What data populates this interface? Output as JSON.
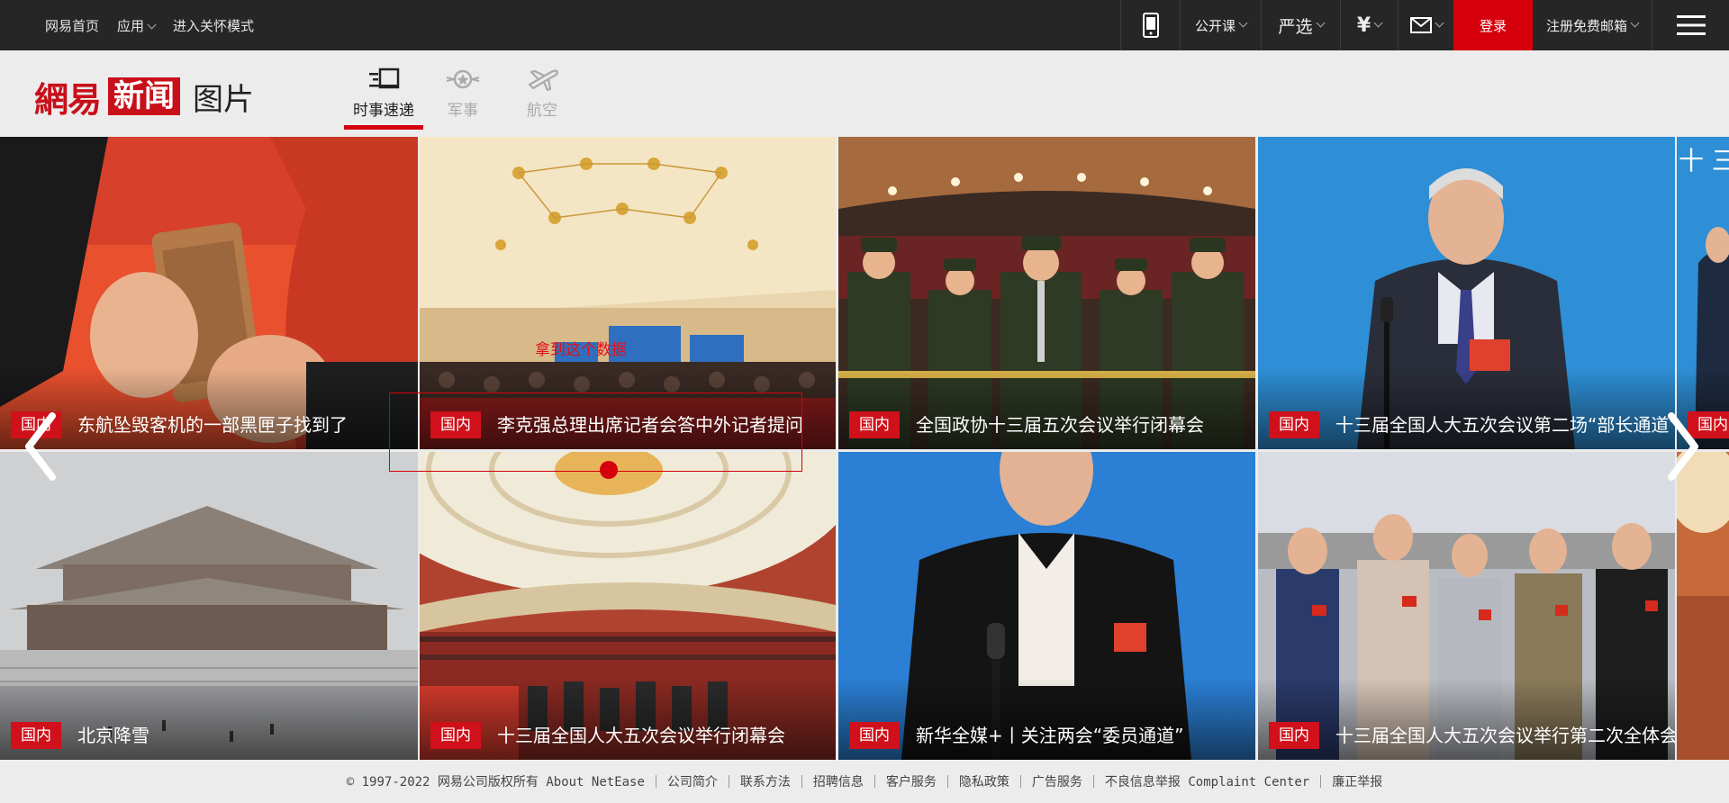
{
  "topbar": {
    "links": [
      "网易首页",
      "应用",
      "进入关怀模式"
    ],
    "open_course": "公开课",
    "yanxuan": "严选",
    "currency_icon": "yen-icon",
    "login": "登录",
    "register": "注册免费邮箱"
  },
  "header": {
    "logo_wy": "網易",
    "logo_news": "新闻",
    "logo_section": "图片",
    "tabs": [
      {
        "label": "时事速递",
        "icon": "news-icon",
        "active": true
      },
      {
        "label": "军事",
        "icon": "military-icon",
        "active": false
      },
      {
        "label": "航空",
        "icon": "airplane-icon",
        "active": false
      }
    ]
  },
  "tiles": [
    {
      "category": "国内",
      "title": "东航坠毁客机的一部黑匣子找到了"
    },
    {
      "category": "国内",
      "title": "李克强总理出席记者会答中外记者提问"
    },
    {
      "category": "国内",
      "title": "全国政协十三届五次会议举行闭幕会"
    },
    {
      "category": "国内",
      "title": "十三届全国人大五次会议第二场“部长通道”"
    },
    {
      "category": "国内",
      "title": ""
    },
    {
      "category": "国内",
      "title": "北京降雪"
    },
    {
      "category": "国内",
      "title": "十三届全国人大五次会议举行闭幕会"
    },
    {
      "category": "国内",
      "title": "新华全媒+丨关注两会“委员通道”"
    },
    {
      "category": "国内",
      "title": "十三届全国人大五次会议举行第二次全体会议"
    }
  ],
  "annotation": {
    "text": "拿到这个数据"
  },
  "footer": {
    "items": [
      "© 1997-2022 网易公司版权所有 About NetEase",
      "公司简介",
      "联系方法",
      "招聘信息",
      "客户服务",
      "隐私政策",
      "广告服务",
      "不良信息举报 Complaint Center",
      "廉正举报"
    ]
  },
  "colors": {
    "accent": "#d5000b",
    "topbar_bg": "#262626",
    "page_bg": "#ececec"
  }
}
